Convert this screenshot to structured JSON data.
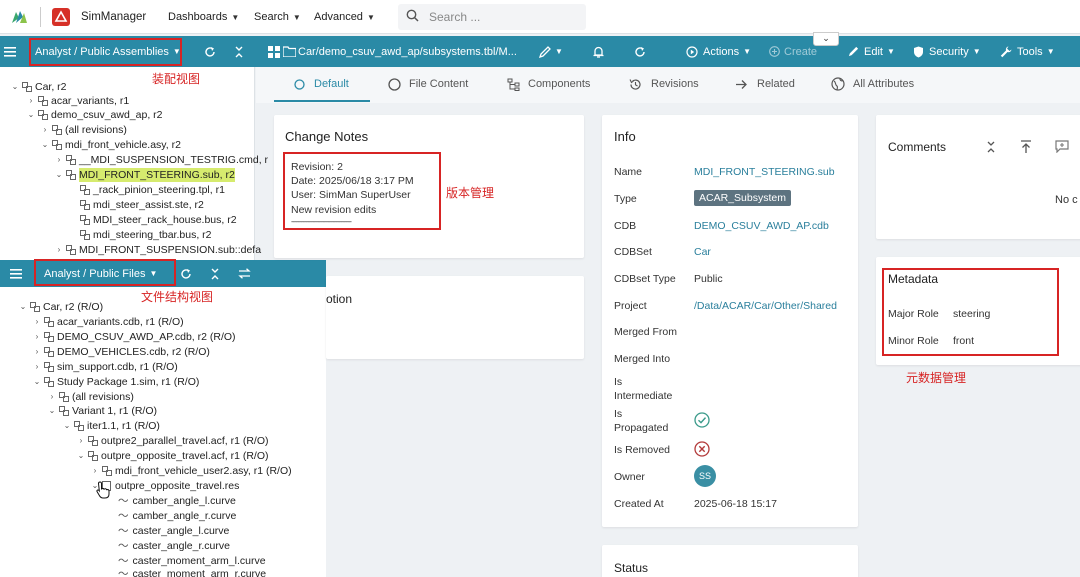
{
  "topbar": {
    "app_name": "SimManager",
    "menus": [
      "Dashboards",
      "Search",
      "Advanced"
    ],
    "search_placeholder": "Search ..."
  },
  "bar2": {
    "view_selector": "Analyst / Public Assemblies",
    "path": "Car/demo_csuv_awd_ap/subsystems.tbl/M...",
    "actions": "Actions",
    "create": "Create",
    "edit": "Edit",
    "security": "Security",
    "tools": "Tools"
  },
  "tree1": {
    "rows": [
      "Car, r2",
      "acar_variants, r1",
      "demo_csuv_awd_ap, r2",
      "(all revisions)",
      "mdi_front_vehicle.asy, r2",
      "__MDI_SUSPENSION_TESTRIG.cmd, r",
      "MDI_FRONT_STEERING.sub, r2",
      "_rack_pinion_steering.tpl, r1",
      "mdi_steer_assist.ste, r2",
      "MDI_steer_rack_house.bus, r2",
      "mdi_steering_tbar.bus, r2",
      "MDI_FRONT_SUSPENSION.sub::defa"
    ]
  },
  "bar3": {
    "view_selector": "Analyst / Public Files"
  },
  "tree2": {
    "rows": [
      "Car, r2 (R/O)",
      "acar_variants.cdb, r1 (R/O)",
      "DEMO_CSUV_AWD_AP.cdb, r2 (R/O)",
      "DEMO_VEHICLES.cdb, r2 (R/O)",
      "sim_support.cdb, r1 (R/O)",
      "Study Package 1.sim, r1 (R/O)",
      "(all revisions)",
      "Variant 1, r1 (R/O)",
      "iter1.1, r1 (R/O)",
      "outpre2_parallel_travel.acf, r1 (R/O)",
      "outpre_opposite_travel.acf, r1 (R/O)",
      "mdi_front_vehicle_user2.asy, r1 (R/O)",
      "outpre_opposite_travel.res",
      "camber_angle_l.curve",
      "camber_angle_r.curve",
      "caster_angle_l.curve",
      "caster_angle_r.curve",
      "caster_moment_arm_l.curve",
      "caster_moment_arm_r.curve"
    ]
  },
  "tabs": [
    "Default",
    "File Content",
    "Components",
    "Revisions",
    "Related",
    "All Attributes"
  ],
  "change_notes": {
    "title": "Change Notes",
    "revision": "Revision: 2",
    "date": "Date: 2025/06/18 3:17 PM",
    "user": "User: SimMan SuperUser",
    "note": "New revision edits",
    "dashes": "------------------------------------"
  },
  "desc_card": {
    "partial_title": "otion"
  },
  "info": {
    "title": "Info",
    "labels": {
      "name": "Name",
      "type": "Type",
      "cdb": "CDB",
      "cdbset": "CDBSet",
      "cdbset_type": "CDBset Type",
      "project": "Project",
      "merged_from": "Merged From",
      "merged_into": "Merged Into",
      "is_intermediate_1": "Is",
      "is_intermediate_2": "Intermediate",
      "is_propagated_1": "Is",
      "is_propagated_2": "Propagated",
      "is_removed": "Is Removed",
      "owner": "Owner",
      "created_at": "Created At"
    },
    "values": {
      "name": "MDI_FRONT_STEERING.sub",
      "type": "ACAR_Subsystem",
      "cdb": "DEMO_CSUV_AWD_AP.cdb",
      "cdbset": "Car",
      "cdbset_type": "Public",
      "project": "/Data/ACAR/Car/Other/Shared",
      "owner": "SS",
      "created_at": "2025-06-18 15:17"
    }
  },
  "status_card": {
    "title": "Status"
  },
  "comments": {
    "title": "Comments",
    "partial": "No c"
  },
  "metadata": {
    "title": "Metadata",
    "major_role_label": "Major Role",
    "major_role": "steering",
    "minor_role_label": "Minor Role",
    "minor_role": "front"
  },
  "annotations": {
    "assembly_view": "装配视图",
    "version_mgmt": "版本管理",
    "file_view": "文件结构视图",
    "metadata_mgmt": "元数据管理"
  },
  "colors": {
    "teal": "#2a8aa6",
    "highlight": "#d6eb6e",
    "annotation": "#d72424"
  }
}
